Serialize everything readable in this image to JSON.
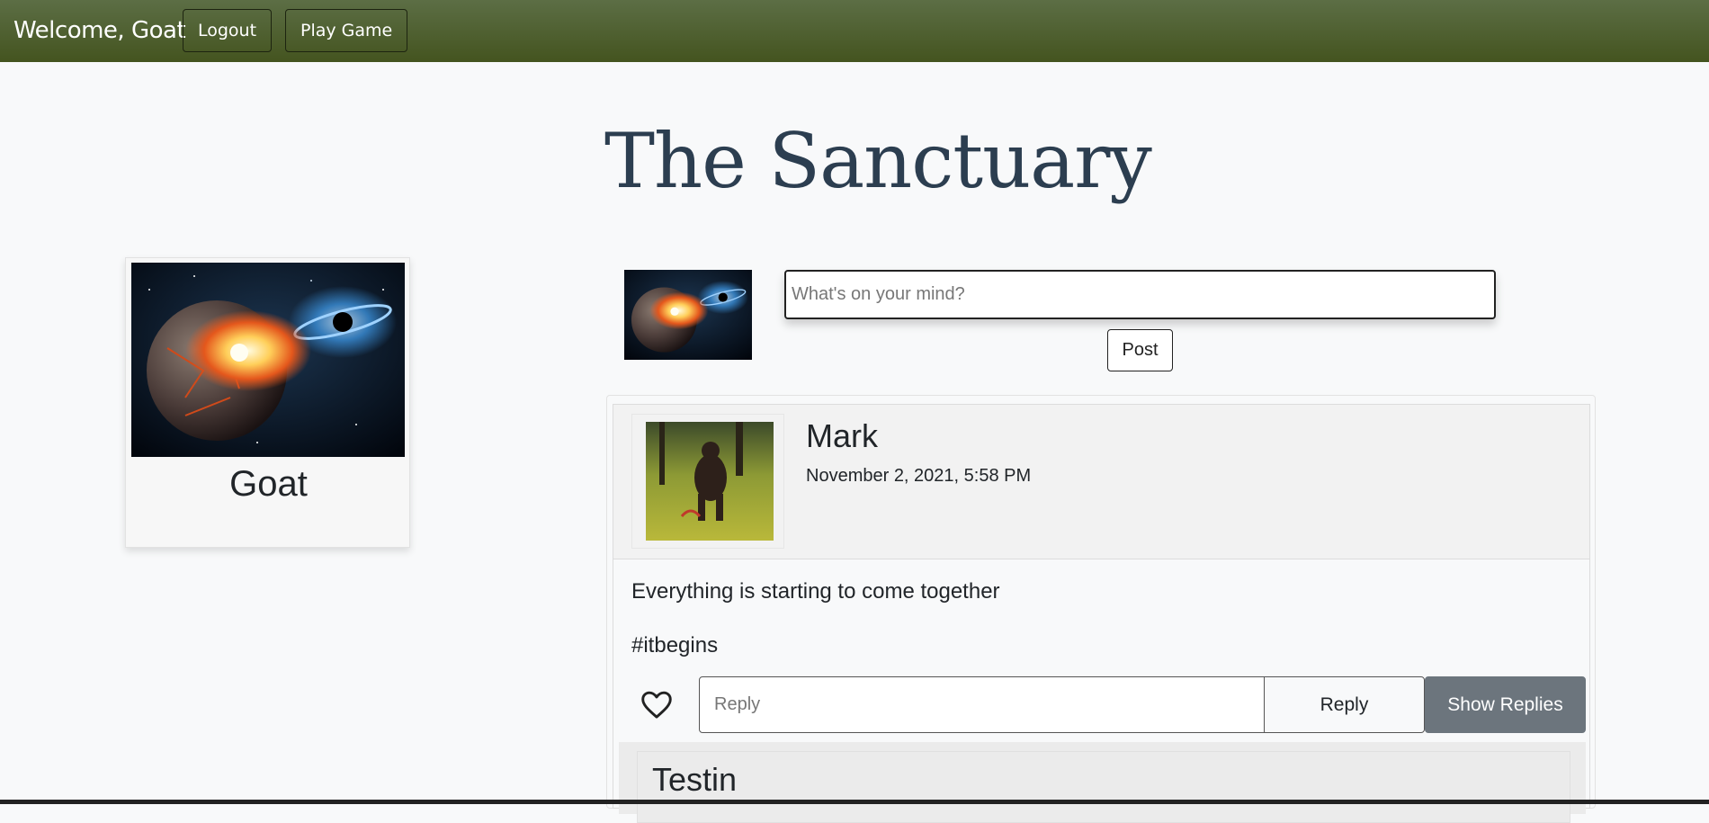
{
  "nav": {
    "welcome": "Welcome, Goat",
    "logout_label": "Logout",
    "play_label": "Play Game"
  },
  "page": {
    "title": "The Sanctuary"
  },
  "profile": {
    "name": "Goat",
    "image": "galaxy-collision-image"
  },
  "composer": {
    "placeholder": "What's on your mind?",
    "post_label": "Post"
  },
  "posts": [
    {
      "author": "Mark",
      "timestamp": "November 2, 2021, 5:58 PM",
      "body": [
        "Everything is starting to come together",
        "#itbegins"
      ],
      "like_icon": "heart-icon",
      "reply_placeholder": "Reply",
      "reply_label": "Reply",
      "show_replies_label": "Show Replies",
      "replies": [
        {
          "author": "Testin"
        }
      ]
    }
  ],
  "colors": {
    "navbar_top": "#5c6e45",
    "navbar_bottom": "#44541f",
    "title": "#2c3e50",
    "secondary_button": "#6c757d"
  }
}
